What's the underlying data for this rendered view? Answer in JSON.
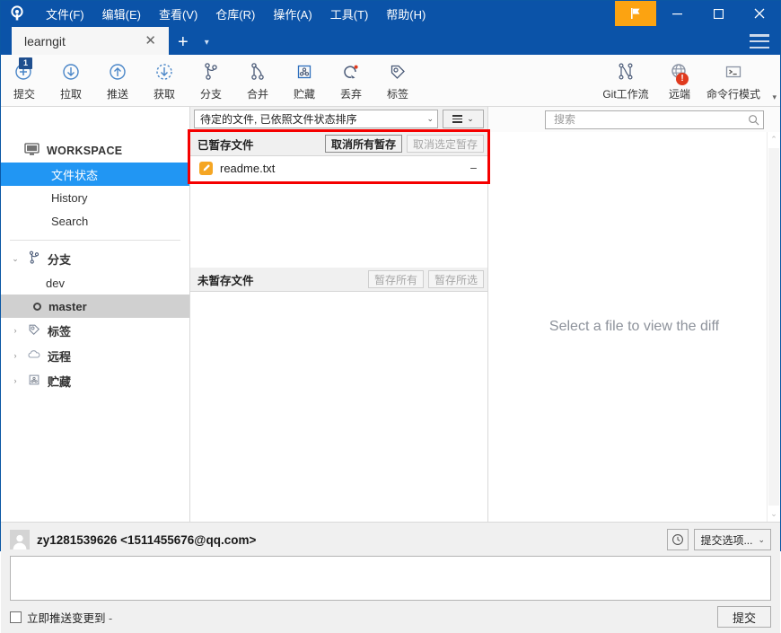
{
  "window": {
    "menu": [
      {
        "label": "文件(F)",
        "mnemonic": "F"
      },
      {
        "label": "编辑(E)",
        "mnemonic": "E"
      },
      {
        "label": "查看(V)",
        "mnemonic": "V"
      },
      {
        "label": "仓库(R)",
        "mnemonic": "R"
      },
      {
        "label": "操作(A)",
        "mnemonic": "A"
      },
      {
        "label": "工具(T)",
        "mnemonic": "T"
      },
      {
        "label": "帮助(H)",
        "mnemonic": "H"
      }
    ],
    "controls": {
      "minimize": "—",
      "maximize": "□",
      "close": "✕"
    },
    "accent_color": "#0b53a8",
    "flag_color": "#fca311"
  },
  "tabs": {
    "items": [
      {
        "label": "learngit",
        "active": true
      }
    ],
    "close_label": "✕",
    "new_tab_label": "+",
    "tab_menu_label": "▾"
  },
  "toolbar": {
    "items": [
      {
        "label": "提交",
        "icon": "commit-icon",
        "badge": "1"
      },
      {
        "label": "拉取",
        "icon": "pull-icon"
      },
      {
        "label": "推送",
        "icon": "push-icon"
      },
      {
        "label": "获取",
        "icon": "fetch-icon"
      },
      {
        "label": "分支",
        "icon": "branch-icon"
      },
      {
        "label": "合并",
        "icon": "merge-icon"
      },
      {
        "label": "贮藏",
        "icon": "stash-icon"
      },
      {
        "label": "丢弃",
        "icon": "discard-icon"
      },
      {
        "label": "标签",
        "icon": "tag-icon"
      }
    ],
    "right_items": [
      {
        "label": "Git工作流",
        "icon": "gitflow-icon"
      },
      {
        "label": "远端",
        "icon": "remote-globe-icon",
        "badge": "!"
      },
      {
        "label": "命令行模式",
        "icon": "terminal-icon"
      }
    ],
    "overflow_label": "▾"
  },
  "search": {
    "placeholder": "搜索",
    "value": "",
    "icon": "search-icon"
  },
  "sidebar": {
    "workspace": {
      "label": "WORKSPACE",
      "icon": "monitor-icon"
    },
    "workspace_items": [
      {
        "label": "文件状态",
        "selected": true
      },
      {
        "label": "History",
        "selected": false
      },
      {
        "label": "Search",
        "selected": false
      }
    ],
    "groups": [
      {
        "label": "分支",
        "icon": "branch-icon",
        "expanded": true,
        "chevron": "⌄",
        "children": [
          {
            "label": "dev",
            "current": false
          },
          {
            "label": "master",
            "current": true
          }
        ]
      },
      {
        "label": "标签",
        "icon": "tag-icon",
        "expanded": false,
        "chevron": "›",
        "children": []
      },
      {
        "label": "远程",
        "icon": "cloud-icon",
        "expanded": false,
        "chevron": "›",
        "children": []
      },
      {
        "label": "贮藏",
        "icon": "stash-icon",
        "expanded": false,
        "chevron": "›",
        "children": []
      }
    ]
  },
  "filebar": {
    "filter_label": "待定的文件, 已依照文件状态排序",
    "filter_caret": "⌄",
    "list_mode_caret": "⌄"
  },
  "staged": {
    "title": "已暂存文件",
    "unstage_all_label": "取消所有暂存",
    "unstage_selected_label": "取消选定暂存",
    "unstage_selected_disabled": true,
    "files": [
      {
        "name": "readme.txt",
        "status_icon": "modified-pencil-icon",
        "action": "−"
      }
    ]
  },
  "unstaged": {
    "title": "未暂存文件",
    "stage_all_label": "暂存所有",
    "stage_selected_label": "暂存所选",
    "stage_all_disabled": true,
    "stage_selected_disabled": true,
    "files": []
  },
  "diff": {
    "empty_text": "Select a file to view the diff",
    "scroll_up": "⌃",
    "scroll_down": "⌄"
  },
  "commit": {
    "author": "zy1281539626 <1511455676@qq.com>",
    "avatar_icon": "person-avatar-icon",
    "history_icon": "clock-icon",
    "options_label": "提交选项...",
    "options_caret": "⌄",
    "message_value": "",
    "push_checkbox_label": "立即推送变更到",
    "push_target": "-",
    "push_checked": false,
    "commit_button_label": "提交"
  },
  "annotation": {
    "color": "#f50000"
  }
}
